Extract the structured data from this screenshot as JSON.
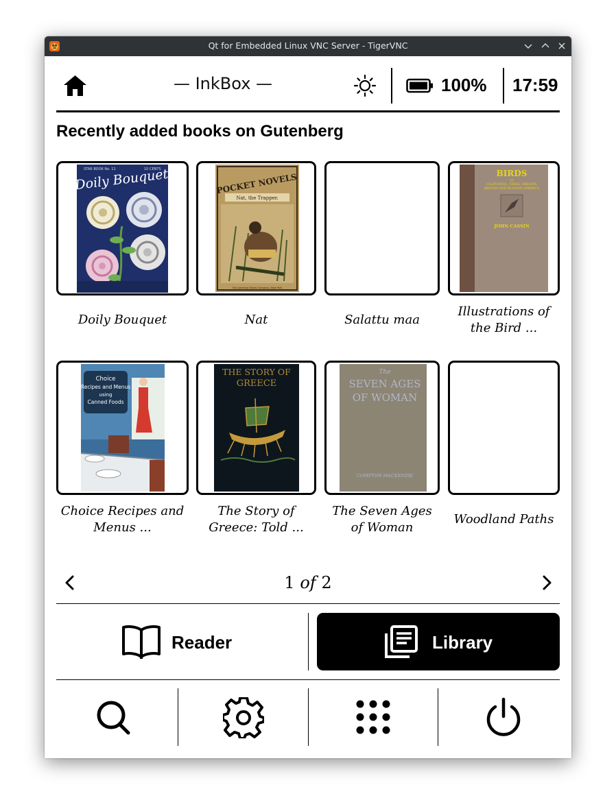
{
  "window": {
    "title": "Qt for Embedded Linux VNC Server - TigerVNC",
    "controls": [
      "minimize-icon",
      "maximize-icon",
      "close-icon"
    ]
  },
  "header": {
    "brand": "— InkBox —",
    "battery_percent": "100%",
    "clock": "17:59",
    "icons": [
      "home-icon",
      "brightness-icon",
      "battery-icon"
    ]
  },
  "section": {
    "title": "Recently added books on Gutenberg"
  },
  "books": [
    {
      "title": "Doily Bouquet",
      "cover": "doily"
    },
    {
      "title": "Nat",
      "cover": "pocket"
    },
    {
      "title": "Salattu maa",
      "cover": "none"
    },
    {
      "title": "Illustrations of the Bird ...",
      "cover": "birds"
    },
    {
      "title": "Choice Recipes and Menus  ...",
      "cover": "recipes"
    },
    {
      "title": "The Story of Greece: Told ...",
      "cover": "greece"
    },
    {
      "title": "The Seven Ages of Woman",
      "cover": "seven"
    },
    {
      "title": "Woodland Paths",
      "cover": "none"
    }
  ],
  "covers": {
    "doily": {
      "line1": "Doily Bouquet",
      "tag": "STAR BOOK No. 11",
      "price": "10 CENTS"
    },
    "pocket": {
      "line1": "POCKET NOVELS",
      "line2": "Nat, the Trapper.",
      "footer": "The American News Company, New York"
    },
    "birds": {
      "line1": "BIRDS",
      "line2": "OF",
      "line3": "CALIFORNIA, TEXAS, OREGON,",
      "line4": "BRITISH AND RUSSIAN AMERICA",
      "author": "JOHN CASSIN"
    },
    "recipes": {
      "line1": "Choice",
      "line2": "Recipes and Menus",
      "line3": "using",
      "line4": "Canned Foods"
    },
    "greece": {
      "line1": "THE STORY OF",
      "line2": "GREECE"
    },
    "seven": {
      "line1": "The",
      "line2": "SEVEN AGES",
      "line3": "OF WOMAN",
      "author": "COMPTON MACKENZIE"
    }
  },
  "pager": {
    "current": "1",
    "of": "of",
    "total": "2"
  },
  "nav": {
    "reader_label": "Reader",
    "library_label": "Library"
  },
  "bottom_bar": [
    "search-icon",
    "settings-icon",
    "apps-icon",
    "power-icon"
  ]
}
